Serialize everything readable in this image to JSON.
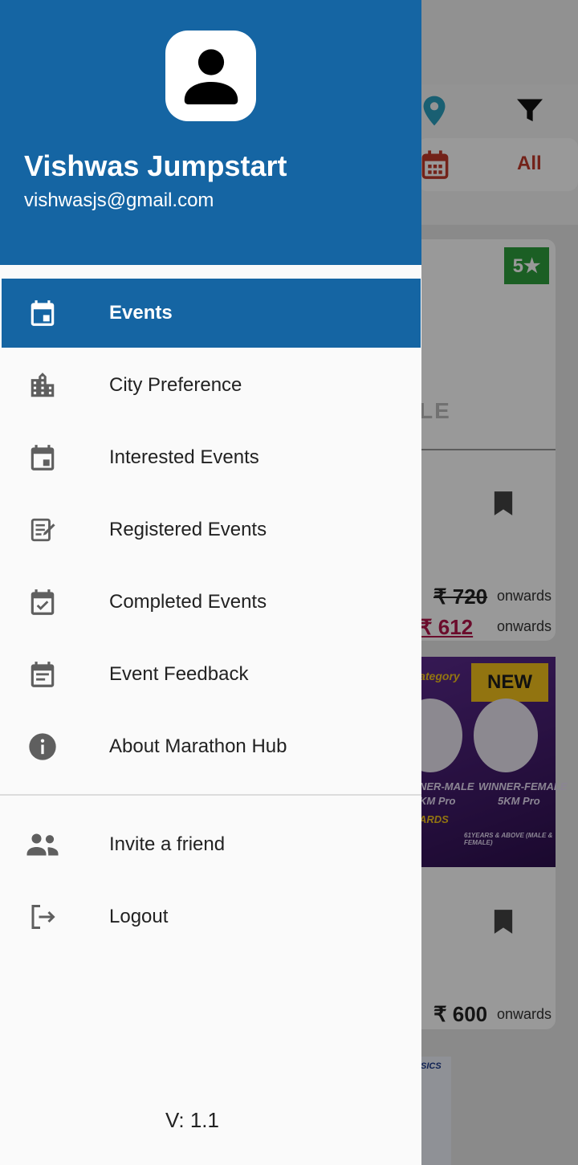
{
  "background": {
    "filter_all": "All",
    "rating": "5★",
    "partial_text": "LE",
    "price_old": "₹ 720",
    "price_new": "₹ 612",
    "price_3": "₹ 600",
    "onwards": "onwards",
    "promo_new": "NEW",
    "promo_category": "Category",
    "winner_male": "NER-MALE",
    "winner_male_sub": "KM Pro",
    "winner_female": "WINNER-FEMALE",
    "winner_female_sub": "5KM Pro",
    "awards": "ARDS",
    "age_note": "61YEARS & ABOVE (MALE & FEMALE)",
    "partial_brand": "SICS"
  },
  "drawer": {
    "user": {
      "name": "Vishwas Jumpstart",
      "email": "vishwasjs@gmail.com"
    },
    "items": [
      {
        "label": "Events",
        "icon": "calendar-icon",
        "active": true
      },
      {
        "label": "City Preference",
        "icon": "city-icon"
      },
      {
        "label": "Interested Events",
        "icon": "calendar-icon"
      },
      {
        "label": "Registered Events",
        "icon": "edit-note-icon"
      },
      {
        "label": "Completed Events",
        "icon": "calendar-check-icon"
      },
      {
        "label": "Event Feedback",
        "icon": "calendar-note-icon"
      },
      {
        "label": "About Marathon Hub",
        "icon": "info-icon"
      }
    ],
    "secondary_items": [
      {
        "label": "Invite a friend",
        "icon": "group-icon"
      },
      {
        "label": "Logout",
        "icon": "logout-icon"
      }
    ],
    "version": "V: 1.1"
  },
  "colors": {
    "primary": "#1565a3",
    "drawer_bg": "#fafafa",
    "rating_green": "#2e9e3c",
    "price_red": "#b2154a"
  }
}
